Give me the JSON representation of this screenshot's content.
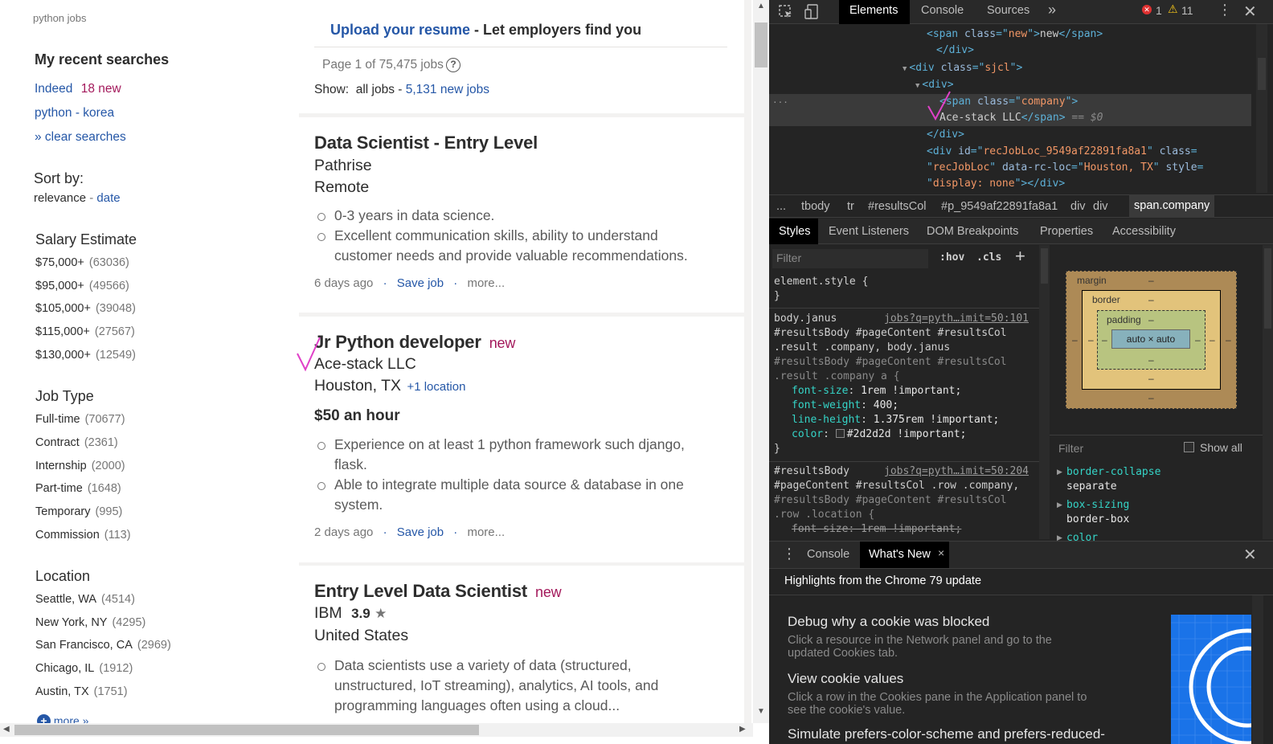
{
  "left": {
    "query": "python jobs",
    "recent_heading": "My recent searches",
    "recent": [
      {
        "label": "Indeed",
        "badge": "18 new"
      },
      {
        "label": "python - korea"
      },
      {
        "label": "» clear searches"
      }
    ],
    "sort_heading": "Sort by:",
    "sort_active": "relevance",
    "sort_sep": " - ",
    "sort_other": "date",
    "salary_heading": "Salary Estimate",
    "salary": [
      {
        "label": "$75,000+",
        "count": "(63036)"
      },
      {
        "label": "$95,000+",
        "count": "(49566)"
      },
      {
        "label": "$105,000+",
        "count": "(39048)"
      },
      {
        "label": "$115,000+",
        "count": "(27567)"
      },
      {
        "label": "$130,000+",
        "count": "(12549)"
      }
    ],
    "jobtype_heading": "Job Type",
    "jobtype": [
      {
        "label": "Full-time",
        "count": "(70677)"
      },
      {
        "label": "Contract",
        "count": "(2361)"
      },
      {
        "label": "Internship",
        "count": "(2000)"
      },
      {
        "label": "Part-time",
        "count": "(1648)"
      },
      {
        "label": "Temporary",
        "count": "(995)"
      },
      {
        "label": "Commission",
        "count": "(113)"
      }
    ],
    "location_heading": "Location",
    "location": [
      {
        "label": "Seattle, WA",
        "count": "(4514)"
      },
      {
        "label": "New York, NY",
        "count": "(4295)"
      },
      {
        "label": "San Francisco, CA",
        "count": "(2969)"
      },
      {
        "label": "Chicago, IL",
        "count": "(1912)"
      },
      {
        "label": "Austin, TX",
        "count": "(1751)"
      }
    ],
    "more": "more »"
  },
  "main": {
    "upload_link": "Upload your resume",
    "upload_rest": " - Let employers find you",
    "page_info": "Page 1 of 75,475 jobs",
    "help_icon": "?",
    "show_label": "Show:",
    "show_all": "all jobs",
    "show_sep": " - ",
    "show_new": "5,131 new jobs",
    "jobs": [
      {
        "title": "Data Scientist - Entry Level",
        "company": "Pathrise",
        "location": "Remote",
        "bullets": [
          "0-3 years in data science.",
          "Excellent communication skills, ability to understand",
          "customer needs and provide valuable recommendations."
        ],
        "age": "6 days ago",
        "save": "Save job",
        "more": "more..."
      },
      {
        "title": "Jr Python developer",
        "new": "new",
        "company": "Ace-stack LLC",
        "location": "Houston, TX",
        "extra_location": "+1 location",
        "salary": "$50 an hour",
        "bullets": [
          "Experience on at least 1 python framework such django,",
          "flask.",
          "Able to integrate multiple data source & database in one",
          "system."
        ],
        "age": "2 days ago",
        "save": "Save job",
        "more": "more..."
      },
      {
        "title": "Entry Level Data Scientist",
        "new": "new",
        "company": "IBM",
        "rating": "3.9",
        "location": "United States",
        "bullets": [
          "Data scientists use a variety of data (structured,",
          "unstructured, IoT streaming), analytics, AI tools, and",
          "programming languages often using a cloud..."
        ]
      }
    ],
    "dot": "·"
  },
  "devtools": {
    "tabs": [
      "Elements",
      "Console",
      "Sources"
    ],
    "more_tabs": "»",
    "errors": "1",
    "warnings": "11",
    "dom": [
      {
        "indent": 196,
        "parts": [
          [
            "tg",
            "<span "
          ],
          [
            "at",
            "class"
          ],
          [
            "tg",
            "=\""
          ],
          [
            "av",
            "new"
          ],
          [
            "tg",
            "\">"
          ],
          [
            "tx",
            "new"
          ],
          [
            "tg",
            "</span>"
          ]
        ]
      },
      {
        "indent": 208,
        "parts": [
          [
            "tg",
            "</div>"
          ]
        ]
      },
      {
        "indent": 180,
        "arrow": "▼",
        "parts": [
          [
            "tg",
            "<div "
          ],
          [
            "at",
            "class"
          ],
          [
            "tg",
            "=\""
          ],
          [
            "av",
            "sjcl"
          ],
          [
            "tg",
            "\">"
          ]
        ]
      },
      {
        "indent": 196,
        "arrow": "▼",
        "parts": [
          [
            "tg",
            "<div>"
          ]
        ]
      },
      {
        "indent": 212,
        "sel": true,
        "parts": [
          [
            "tg",
            "<span "
          ],
          [
            "at",
            "class"
          ],
          [
            "tg",
            "=\""
          ],
          [
            "av",
            "company"
          ],
          [
            "tg",
            "\">"
          ]
        ]
      },
      {
        "indent": 212,
        "sel": true,
        "parts": [
          [
            "tx",
            "Ace-stack LLC"
          ],
          [
            "tg",
            "</span>"
          ],
          [
            "dim",
            " == $0"
          ]
        ]
      },
      {
        "indent": 196,
        "parts": [
          [
            "tg",
            "</div>"
          ]
        ]
      },
      {
        "indent": 196,
        "parts": [
          [
            "tg",
            "<div "
          ],
          [
            "at",
            "id"
          ],
          [
            "tg",
            "=\""
          ],
          [
            "av",
            "recJobLoc_9549af22891fa8a1"
          ],
          [
            "tg",
            "\" "
          ],
          [
            "at",
            "class"
          ],
          [
            "tg",
            "="
          ]
        ]
      },
      {
        "indent": 196,
        "parts": [
          [
            "tg",
            "\""
          ],
          [
            "av",
            "recJobLoc"
          ],
          [
            "tg",
            "\" "
          ],
          [
            "at",
            "data-rc-loc"
          ],
          [
            "tg",
            "=\""
          ],
          [
            "av",
            "Houston, TX"
          ],
          [
            "tg",
            "\" "
          ],
          [
            "at",
            "style"
          ],
          [
            "tg",
            "="
          ]
        ]
      },
      {
        "indent": 196,
        "parts": [
          [
            "tg",
            "\""
          ],
          [
            "av",
            "display: none"
          ],
          [
            "tg",
            "\"></div>"
          ]
        ]
      }
    ],
    "ellipsis": "...",
    "breadcrumbs": [
      "...",
      "tbody",
      "tr",
      "#resultsCol",
      "#p_9549af22891fa8a1",
      "div",
      "div",
      "span.company"
    ],
    "style_tabs": [
      "Styles",
      "Event Listeners",
      "DOM Breakpoints",
      "Properties",
      "Accessibility"
    ],
    "filter_placeholder": "Filter",
    "hov": ":hov",
    "cls": ".cls",
    "plus": "+",
    "element_style": "element.style {",
    "close_brace": "}",
    "rule1_link": "jobs?q=pyth…imit=50:101",
    "rule1_sel": [
      "body.janus",
      "#resultsBody #pageContent #resultsCol",
      ".result .company, body.janus",
      "#resultsBody #pageContent #resultsCol",
      ".result .company a {"
    ],
    "rule1_props": [
      {
        "name": "font-size",
        "value": "1rem !important;"
      },
      {
        "name": "font-weight",
        "value": "400;"
      },
      {
        "name": "line-height",
        "value": "1.375rem !important;"
      },
      {
        "name": "color",
        "value": "#2d2d2d !important;",
        "swatch": "#2d2d2d"
      }
    ],
    "rule2_link": "jobs?q=pyth…imit=50:204",
    "rule2_sel": [
      "#resultsBody",
      "#pageContent #resultsCol .row .company,",
      "#resultsBody #pageContent #resultsCol",
      ".row .location {"
    ],
    "rule2_prop": {
      "name": "font-size",
      "value": "1rem !important;"
    },
    "box": {
      "margin": "margin",
      "border": "border",
      "padding": "padding",
      "content": "auto × auto",
      "dash": "–"
    },
    "computed_filter": "Filter",
    "show_all": "Show all",
    "computed": [
      {
        "name": "border-collapse",
        "value": "separate"
      },
      {
        "name": "box-sizing",
        "value": "border-box"
      },
      {
        "name": "color",
        "value": ""
      }
    ],
    "drawer_tabs": [
      "Console",
      "What's New"
    ],
    "drawer_close": "×",
    "whatsnew_heading": "Highlights from the Chrome 79 update",
    "whatsnew": [
      {
        "title": "Debug why a cookie was blocked",
        "desc": [
          "Click a resource in the Network panel and go to the",
          "updated Cookies tab."
        ]
      },
      {
        "title": "View cookie values",
        "desc": [
          "Click a row in the Cookies pane in the Application panel to",
          "see the cookie's value."
        ]
      },
      {
        "title": "Simulate prefers-color-scheme and prefers-reduced-",
        "desc": []
      }
    ]
  },
  "colors": {
    "indeed_blue": "#2557a7",
    "new_red": "#a3195b",
    "devtools_bg": "#242424",
    "selection": "#3a3a3a",
    "checkmark": "#e040c8"
  }
}
